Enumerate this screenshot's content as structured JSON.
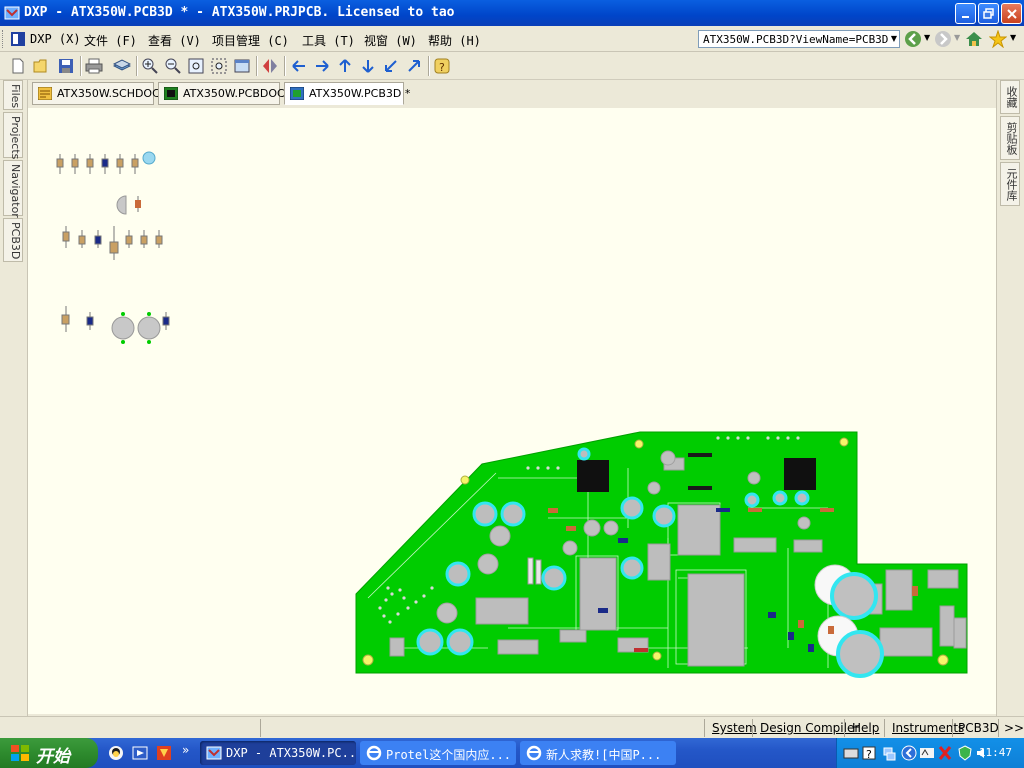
{
  "window": {
    "title": "DXP - ATX350W.PCB3D * - ATX350W.PRJPCB. Licensed to tao"
  },
  "menu": {
    "items": [
      "DXP (X)",
      "文件 (F)",
      "查看 (V)",
      "项目管理 (C)",
      "工具 (T)",
      "视窗 (W)",
      "帮助 (H)"
    ],
    "address": "ATX350W.PCB3D?ViewName=PCB3D"
  },
  "left_panel": {
    "tabs": [
      "Files",
      "Projects",
      "Navigator",
      "PCB3D"
    ]
  },
  "right_panel": {
    "tabs": [
      "收藏",
      "剪贴板",
      "元件库"
    ]
  },
  "doc_tabs": [
    {
      "label": "ATX350W.SCHDOC",
      "icon": "schematic-doc-icon",
      "active": false
    },
    {
      "label": "ATX350W.PCBDOC",
      "icon": "pcb-doc-icon",
      "active": false
    },
    {
      "label": "ATX350W.PCB3D *",
      "icon": "pcb3d-doc-icon",
      "active": true
    }
  ],
  "toolbar": {
    "icons": [
      "new-icon",
      "open-icon",
      "save-icon",
      "print-icon",
      "layers-icon",
      "zoom-in-icon",
      "zoom-out-icon",
      "zoom-fit-icon",
      "zoom-area-icon",
      "zoom-window-icon",
      "flip-icon",
      "arrow-left-icon",
      "arrow-right-icon",
      "arrow-up-icon",
      "arrow-down-icon",
      "rotate-ccw-icon",
      "rotate-cw-icon",
      "help-icon"
    ]
  },
  "status_bar": {
    "buttons": [
      "System",
      "Design Compiler",
      "Help",
      "Instruments",
      "PCB3D",
      ">>"
    ]
  },
  "taskbar": {
    "start_label": "开始",
    "tasks": [
      {
        "label": "DXP - ATX350W.PC...",
        "active": true
      },
      {
        "label": "Protel这个国内应...",
        "active": false
      },
      {
        "label": "新人求教![中国P...",
        "active": false
      }
    ],
    "clock": "11:47"
  },
  "colors": {
    "pcb_green": "#00CC00",
    "canvas_bg": "#FFFFF0",
    "cap_cyan": "#33E6F0",
    "chip_black": "#101010",
    "titlebar_blue": "#0A5FE0"
  }
}
